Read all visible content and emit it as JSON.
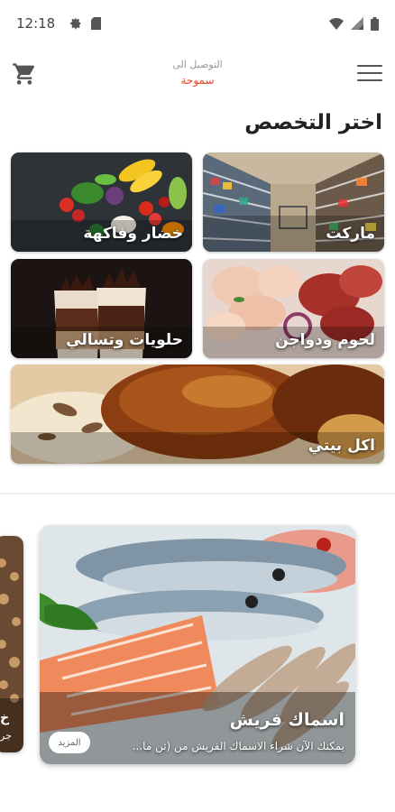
{
  "status_bar": {
    "time": "12:18",
    "left_icons": [
      "gear-icon",
      "sim-card-icon"
    ],
    "right_icons": [
      "wifi-icon",
      "cellular-signal-icon",
      "battery-icon"
    ]
  },
  "header": {
    "delivery_label": "التوصيل الى",
    "delivery_city": "سموحة",
    "accent_color": "#e8462b",
    "left_icon": "cart-icon",
    "right_icon": "menu-icon"
  },
  "section_title": "اختر التخصص",
  "categories": [
    {
      "label": "ماركت",
      "image": "supermarket-aisle"
    },
    {
      "label": "خضار وفاكهة",
      "image": "vegetables-and-fruits"
    },
    {
      "label": "لحوم ودواجن",
      "image": "meat-and-poultry"
    },
    {
      "label": "حلويات وتسالي",
      "image": "desserts-and-snacks"
    },
    {
      "label": "اكل بيتي",
      "image": "home-cooked-roast-chicken"
    }
  ],
  "offers": {
    "peek_card": {
      "title": "خ",
      "subtitle": "جر"
    },
    "main_card": {
      "title": "اسماك فريش",
      "description": "يمكنك الآن شراء الاسماك الفريش من (ثن ما...",
      "more_label": "المزيد",
      "image": "fresh-fish-salmon-shrimp"
    }
  }
}
